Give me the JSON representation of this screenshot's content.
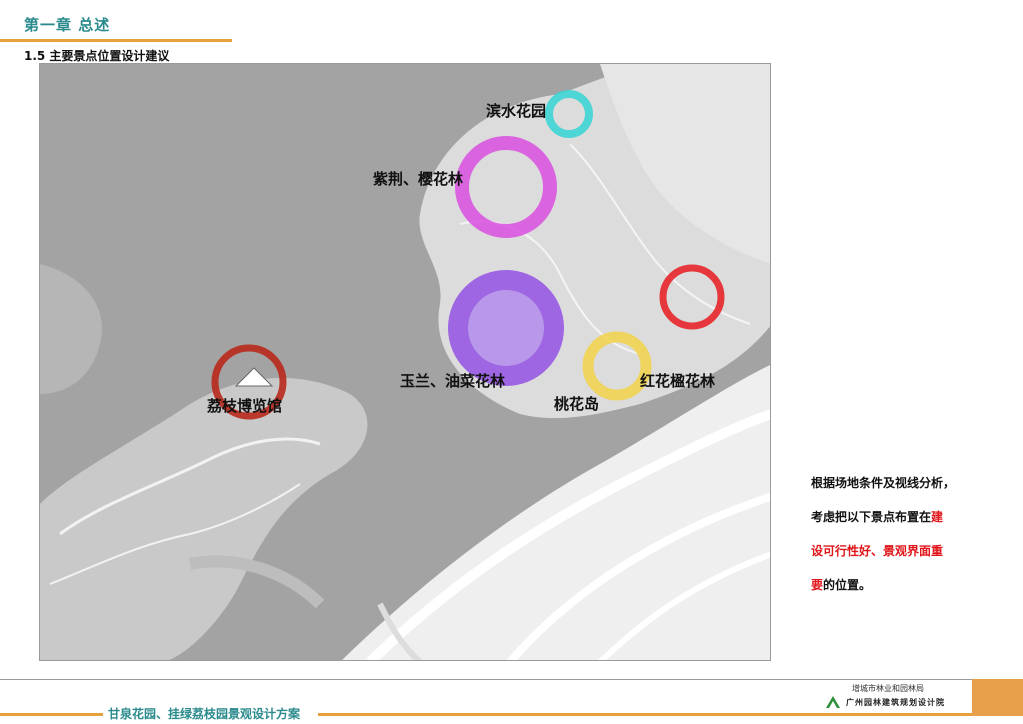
{
  "header": {
    "chapter": "第一章   总述",
    "section": "1.5 主要景点位置设计建议"
  },
  "map": {
    "labels": {
      "binshui": "滨水花园",
      "zijing": "紫荆、樱花林",
      "yulan": "玉兰、油菜花林",
      "taohua": "桃花岛",
      "hongfeng": "红花楹花林",
      "lizhi": "荔枝博览馆"
    },
    "colors": {
      "binshui": "#35d4d4",
      "zijing": "#d94fe0",
      "yulan": "#8a3fe6",
      "taohua": "#f2d24a",
      "hongfeng": "#e5252a",
      "lizhi": "#b8291b"
    }
  },
  "description": {
    "line1": "根据场地条件及视线分析，",
    "line2_a": "考虑把以下景点布置在",
    "line2_b": "建",
    "line3": "设可行性好、景观界面重",
    "line4_a": "要",
    "line4_b": "的位置。"
  },
  "footer": {
    "title": "甘泉花园、挂绿荔枝园景观设计方案",
    "org1": "增城市林业和园林局",
    "org2": "广州园林建筑规划设计院"
  }
}
